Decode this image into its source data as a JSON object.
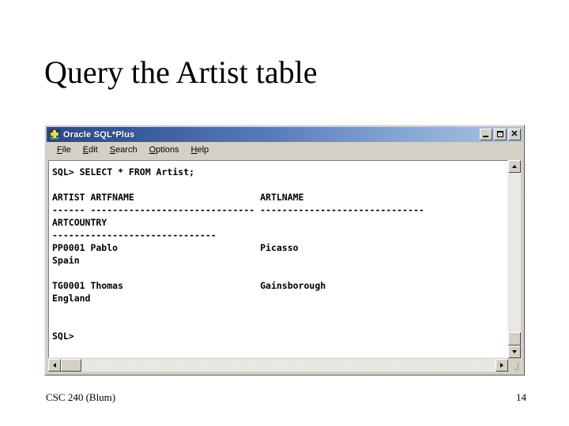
{
  "slide": {
    "title": "Query the Artist table",
    "footer_left": "CSC 240 (Blum)",
    "footer_right": "14",
    "background_color": "#ffffff"
  },
  "window": {
    "title": "Oracle SQL*Plus",
    "icon": "oracle-sqlplus-icon",
    "titlebar_gradient_start": "#2c4a86",
    "titlebar_gradient_end": "#a9c4e4",
    "chrome_color": "#d4d0c8",
    "controls": [
      {
        "name": "minimize",
        "label": "_"
      },
      {
        "name": "maximize",
        "label": "□"
      },
      {
        "name": "close",
        "label": "✕"
      }
    ],
    "menu": [
      {
        "label": "File",
        "accel": "F",
        "rest": "ile"
      },
      {
        "label": "Edit",
        "accel": "E",
        "rest": "dit"
      },
      {
        "label": "Search",
        "accel": "S",
        "rest": "earch"
      },
      {
        "label": "Options",
        "accel": "O",
        "rest": "ptions"
      },
      {
        "label": "Help",
        "accel": "H",
        "rest": "elp"
      }
    ]
  },
  "terminal": {
    "background_color": "#ffffff",
    "text_color": "#000000",
    "content": "SQL> SELECT * FROM Artist;\n\nARTIST ARTFNAME                       ARTLNAME\n------ ------------------------------ ------------------------------\nARTCOUNTRY\n------------------------------\nPP0001 Pablo                          Picasso\nSpain\n\nTG0001 Thomas                         Gainsborough\nEngland\n\n\nSQL>",
    "prompt": "SQL>",
    "query": "SELECT * FROM Artist;",
    "columns": [
      "ARTIST",
      "ARTFNAME",
      "ARTLNAME",
      "ARTCOUNTRY"
    ],
    "rows": [
      {
        "ARTIST": "PP0001",
        "ARTFNAME": "Pablo",
        "ARTLNAME": "Picasso",
        "ARTCOUNTRY": "Spain"
      },
      {
        "ARTIST": "TG0001",
        "ARTFNAME": "Thomas",
        "ARTLNAME": "Gainsborough",
        "ARTCOUNTRY": "England"
      }
    ]
  },
  "scrollbars": {
    "vertical": {
      "up_arrow": "▲",
      "down_arrow": "▼",
      "thumb_position": "bottom"
    },
    "horizontal": {
      "left_arrow": "◄",
      "right_arrow": "►",
      "thumb_position": "left"
    }
  }
}
